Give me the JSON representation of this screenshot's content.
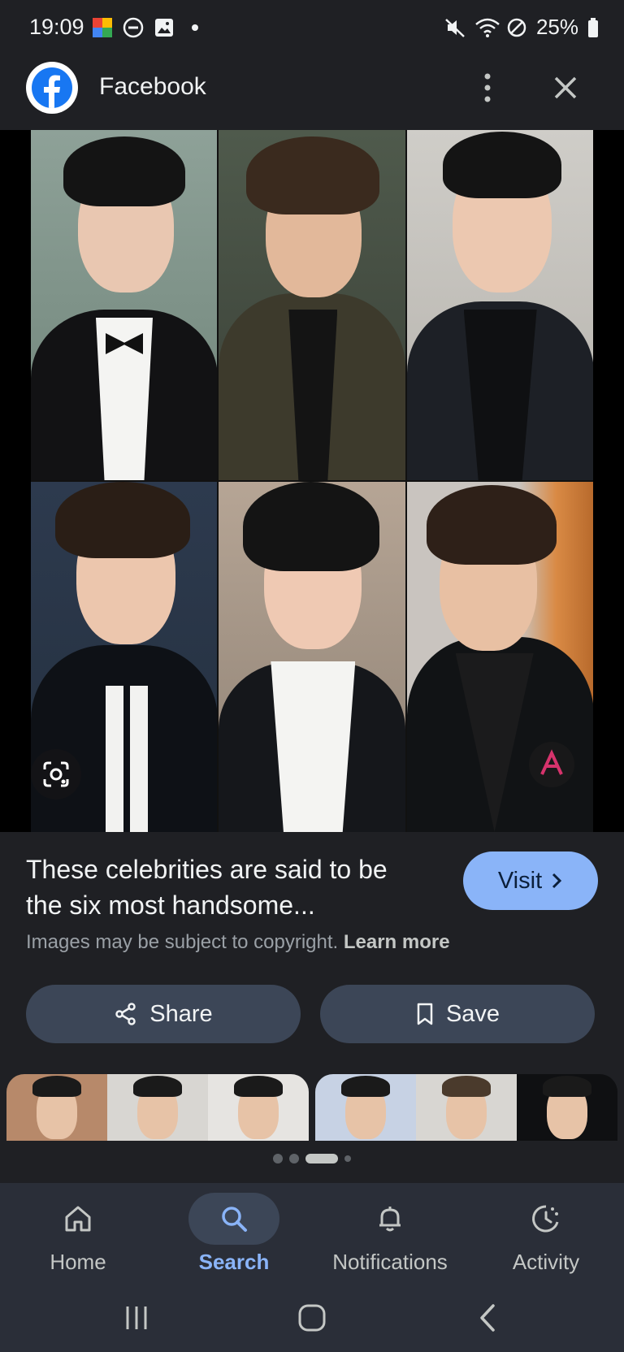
{
  "status_bar": {
    "time": "19:09",
    "battery": "25%",
    "left_icons": [
      "google-photos-icon",
      "dnd-icon",
      "gallery-icon",
      "dot-icon"
    ],
    "right_icons": [
      "mute-icon",
      "wifi-icon",
      "no-sim-icon",
      "battery-icon"
    ]
  },
  "header": {
    "app_name": "Facebook",
    "logo_icon": "facebook-logo",
    "more_icon": "more-vert-icon",
    "close_icon": "close-icon"
  },
  "image": {
    "lens_icon": "google-lens-icon",
    "watermark_icon": "asian-drama-logo"
  },
  "info": {
    "headline": "These celebrities are said to be the six most handsome...",
    "visit_label": "Visit",
    "copyright_text": "Images may be subject to copyright.",
    "learn_more": "Learn more"
  },
  "actions": {
    "share_label": "Share",
    "save_label": "Save"
  },
  "bottom_nav": {
    "items": [
      {
        "label": "Home",
        "icon": "home-icon"
      },
      {
        "label": "Search",
        "icon": "search-icon"
      },
      {
        "label": "Notifications",
        "icon": "bell-icon"
      },
      {
        "label": "Activity",
        "icon": "activity-icon"
      }
    ],
    "active": "Search"
  },
  "colors": {
    "background": "#1f2024",
    "accent": "#8ab4f8",
    "pill": "#3c4657",
    "nav_bg": "#2a2e38"
  }
}
